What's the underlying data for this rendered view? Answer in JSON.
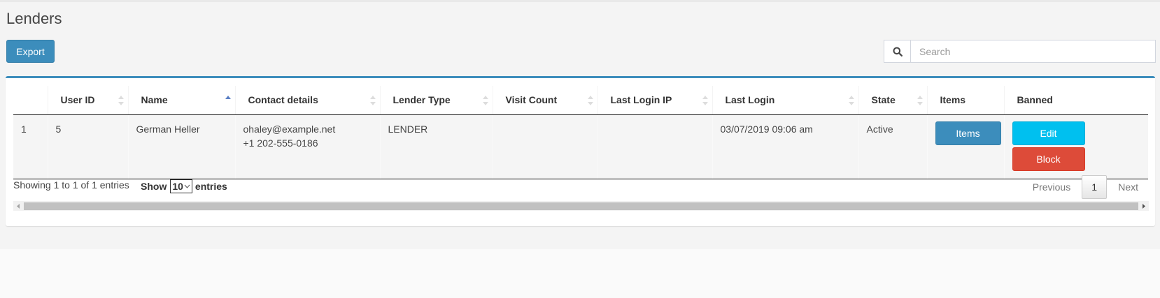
{
  "page": {
    "title": "Lenders"
  },
  "toolbar": {
    "export_label": "Export"
  },
  "search": {
    "placeholder": "Search",
    "value": ""
  },
  "table": {
    "columns": [
      {
        "label": ""
      },
      {
        "label": "User ID"
      },
      {
        "label": "Name"
      },
      {
        "label": "Contact details"
      },
      {
        "label": "Lender Type"
      },
      {
        "label": "Visit Count"
      },
      {
        "label": "Last Login IP"
      },
      {
        "label": "Last Login"
      },
      {
        "label": "State"
      },
      {
        "label": "Items"
      },
      {
        "label": "Banned"
      }
    ],
    "sorted_column": "Name",
    "sort_direction": "ascending",
    "rows": [
      {
        "index": "1",
        "user_id": "5",
        "name": "German Heller",
        "email": "ohaley@example.net",
        "phone": "+1 202-555-0186",
        "lender_type": "LENDER",
        "visit_count": "",
        "last_login_ip": "",
        "last_login": "03/07/2019 09:06 am",
        "state": "Active",
        "items_button": "Items",
        "edit_button": "Edit",
        "block_button": "Block"
      }
    ]
  },
  "footer": {
    "info": "Showing 1 to 1 of 1 entries",
    "show_label": "Show",
    "page_length": "10",
    "entries_label": "entries",
    "previous_label": "Previous",
    "current_page": "1",
    "next_label": "Next"
  },
  "colors": {
    "primary": "#3c8dbc",
    "info": "#00c0ef",
    "danger": "#dd4b39"
  }
}
